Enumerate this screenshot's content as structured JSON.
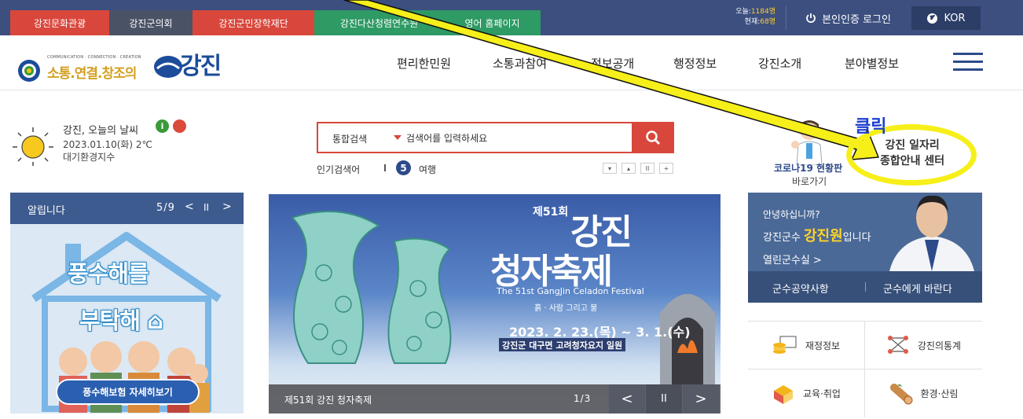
{
  "top_tabs": [
    "강진문화관광",
    "강진군의회",
    "강진군민장학재단",
    "강진다산청렴연수원",
    "영어 홈페이지"
  ],
  "visitors": {
    "today_label": "오늘:",
    "today_value": "1184명",
    "now_label": "현재:",
    "now_value": "68명"
  },
  "login_label": "본인인증 로그인",
  "lang_label": "KOR",
  "logo": {
    "tagline": "COMMUNICATION · CONNECTION · CREATION",
    "slogan": "소통.연결.창조의",
    "name": "강진"
  },
  "nav": [
    "편리한민원",
    "소통과참여",
    "정보공개",
    "행정정보",
    "강진소개",
    "분야별정보"
  ],
  "weather": {
    "title": "강진, 오늘의 날씨",
    "date_temp": "2023.01.10(화) 2℃",
    "air": "대기환경지수"
  },
  "search": {
    "category": "통합검색",
    "placeholder": "검색어를 입력하세요"
  },
  "popular": {
    "label": "인기검색어",
    "rank": "5",
    "word": "여행",
    "controls": [
      "▾",
      "▴",
      "II",
      "+"
    ]
  },
  "quick": {
    "corona_title": "코로나19 현황판",
    "corona_go": "바로가기",
    "job_line1": "강진 일자리",
    "job_line2": "종합안내 센터"
  },
  "annotation": {
    "text": "클릭",
    "color": "#f6ef1a"
  },
  "notice": {
    "title": "알립니다",
    "count": "5/9",
    "promo_line1": "풍수해를",
    "promo_line2": "부탁해",
    "promo_button": "풍수해보험 자세히보기"
  },
  "banner": {
    "edition": "제51회",
    "title1": "강진",
    "title2": "청자축제",
    "english": "The 51st GangJin Celadon Festival",
    "subtitle": "흙 · 사람 그리고 불",
    "dates": "2023. 2. 23.(목) ~ 3. 1.(수)",
    "place": "강진군 대구면 고려청자요지 일원",
    "caption": "제51회 강진 청자축제",
    "page": "1/3"
  },
  "mayor": {
    "hello": "안녕하십니까?",
    "line_prefix": "강진군수 ",
    "name": "강진원",
    "line_suffix": "입니다",
    "room": "열린군수실 >",
    "btn1": "군수공약사항",
    "btn2": "군수에게 바란다"
  },
  "quick_grid": [
    "재정정보",
    "강진의통계",
    "교육·취업",
    "환경·산림"
  ],
  "colors": {
    "topbar": "#3c4f7f",
    "accent_red": "#d9473c",
    "green": "#2e9a64",
    "navy": "#2d4a8a"
  }
}
